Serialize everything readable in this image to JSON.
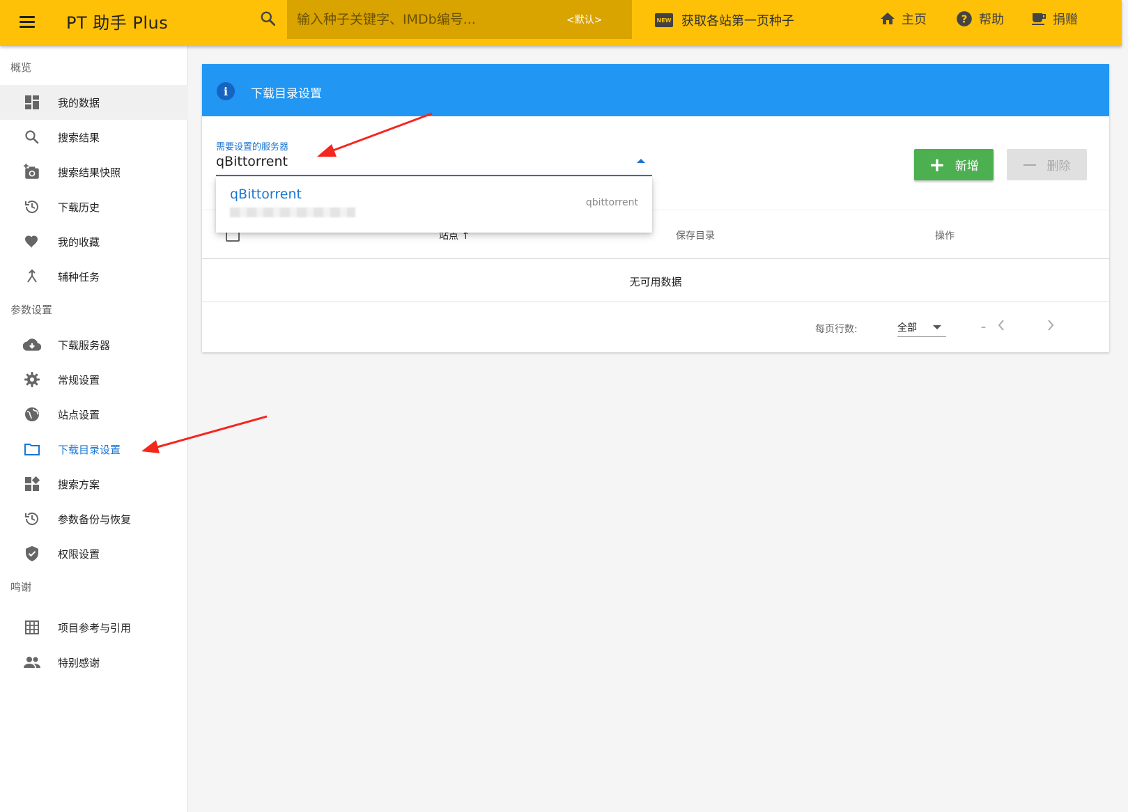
{
  "app": {
    "title": "PT 助手 Plus"
  },
  "search": {
    "placeholder": "输入种子关键字、IMDb编号...",
    "scheme": "<默认>"
  },
  "topbar": {
    "fetch_label": "获取各站第一页种子",
    "new_badge": "NEW",
    "home": "主页",
    "help": "帮助",
    "donate": "捐赠"
  },
  "sidebar": {
    "sections": [
      {
        "header": "概览",
        "items": [
          {
            "label": "我的数据",
            "icon": "dashboard-icon"
          },
          {
            "label": "搜索结果",
            "icon": "search-icon"
          },
          {
            "label": "搜索结果快照",
            "icon": "add-photo-icon"
          },
          {
            "label": "下载历史",
            "icon": "history-icon"
          },
          {
            "label": "我的收藏",
            "icon": "heart-icon"
          },
          {
            "label": "辅种任务",
            "icon": "merge-icon"
          }
        ]
      },
      {
        "header": "参数设置",
        "items": [
          {
            "label": "下载服务器",
            "icon": "cloud-download-icon"
          },
          {
            "label": "常规设置",
            "icon": "gear-icon"
          },
          {
            "label": "站点设置",
            "icon": "globe-icon"
          },
          {
            "label": "下载目录设置",
            "icon": "folder-icon"
          },
          {
            "label": "搜索方案",
            "icon": "widgets-icon"
          },
          {
            "label": "参数备份与恢复",
            "icon": "restore-icon"
          },
          {
            "label": "权限设置",
            "icon": "shield-check-icon"
          }
        ]
      },
      {
        "header": "鸣谢",
        "items": [
          {
            "label": "项目参考与引用",
            "icon": "table-icon"
          },
          {
            "label": "特别感谢",
            "icon": "people-icon"
          }
        ]
      }
    ]
  },
  "card": {
    "title": "下载目录设置",
    "server_field": {
      "label": "需要设置的服务器",
      "value": "qBittorrent"
    },
    "add_button": "新增",
    "delete_button": "删除",
    "table": {
      "columns": [
        "站点",
        "保存目录",
        "操作"
      ],
      "sort_indicator": "↑",
      "empty_text": "无可用数据",
      "rows_per_page_label": "每页行数:",
      "rows_per_page_value": "全部",
      "page_range": "–"
    }
  },
  "dropdown": {
    "items": [
      {
        "name": "qBittorrent",
        "type": "qbittorrent"
      }
    ]
  },
  "colors": {
    "topbar": "#ffc107",
    "header_blue": "#2196f3",
    "accent_blue": "#1976d2",
    "add_green": "#4caf50",
    "annotation_red": "#f5261e"
  }
}
